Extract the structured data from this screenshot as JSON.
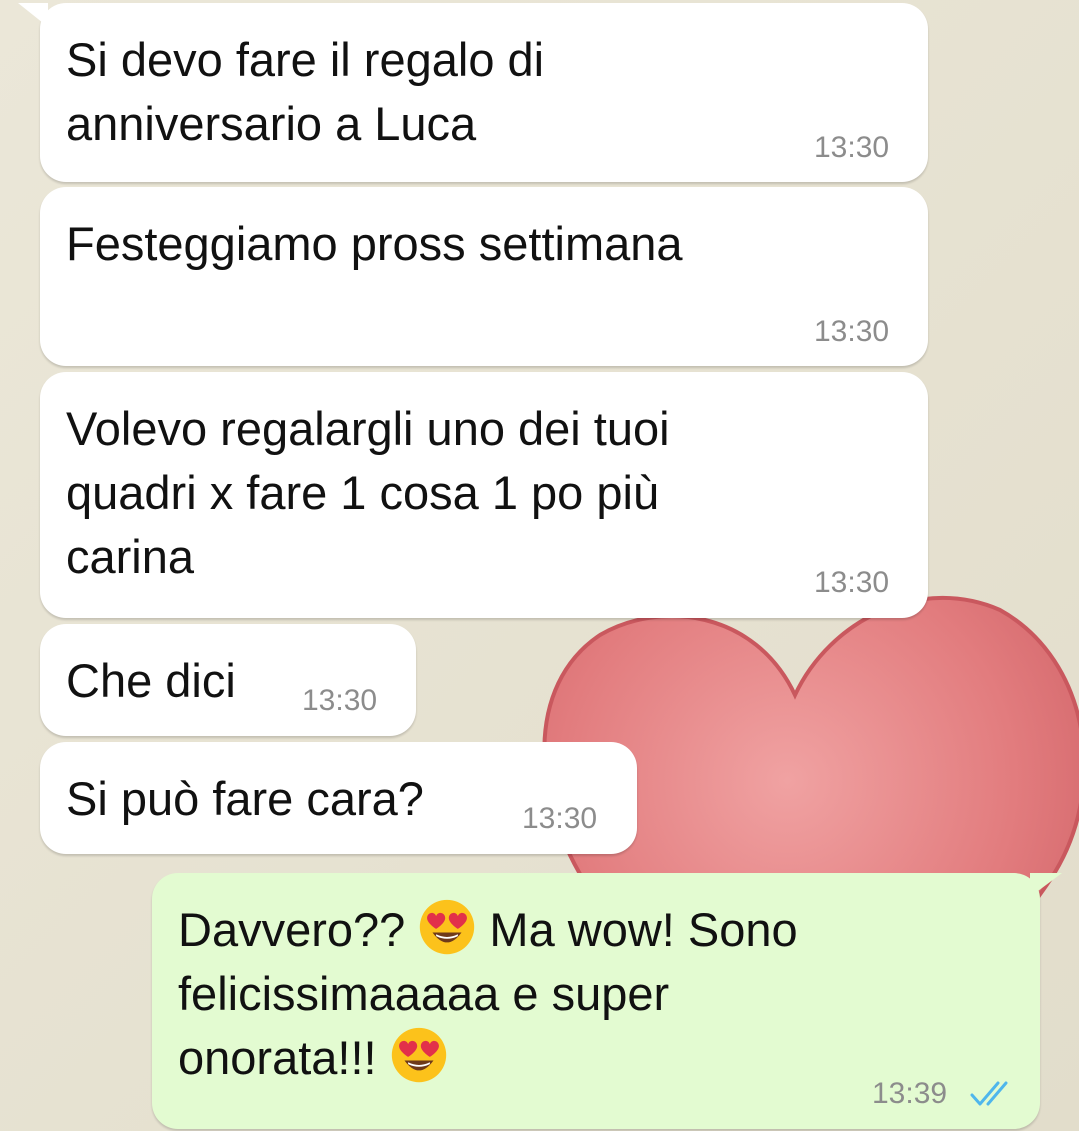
{
  "chat": {
    "messages": [
      {
        "direction": "incoming",
        "text": "Si devo fare il regalo di\nanniversario a Luca",
        "time": "13:30"
      },
      {
        "direction": "incoming",
        "text": "Festeggiamo pross settimana",
        "time": "13:30"
      },
      {
        "direction": "incoming",
        "text": "Volevo regalargli uno dei tuoi\nquadri x fare 1 cosa 1 po più\ncarina",
        "time": "13:30"
      },
      {
        "direction": "incoming",
        "text": "Che dici",
        "time": "13:30"
      },
      {
        "direction": "incoming",
        "text": "Si può fare cara?",
        "time": "13:30"
      },
      {
        "direction": "outgoing",
        "text_part1": "Davvero??",
        "text_part2": "Ma wow! Sono",
        "text_part3": "felicissimaaaaa e super",
        "text_part4": "onorata!!!",
        "emoji": "heart-eyes-emoji",
        "time": "13:39",
        "status": "read"
      }
    ]
  },
  "colors": {
    "incoming_bubble": "#ffffff",
    "outgoing_bubble": "#e3fbd1",
    "read_ticks": "#4fb6ec",
    "wallpaper": "#e6e2d2",
    "heart": "#e27c7e"
  },
  "icons": {
    "read_receipt": "double-check-icon",
    "wallpaper_art": "heart-icon"
  }
}
